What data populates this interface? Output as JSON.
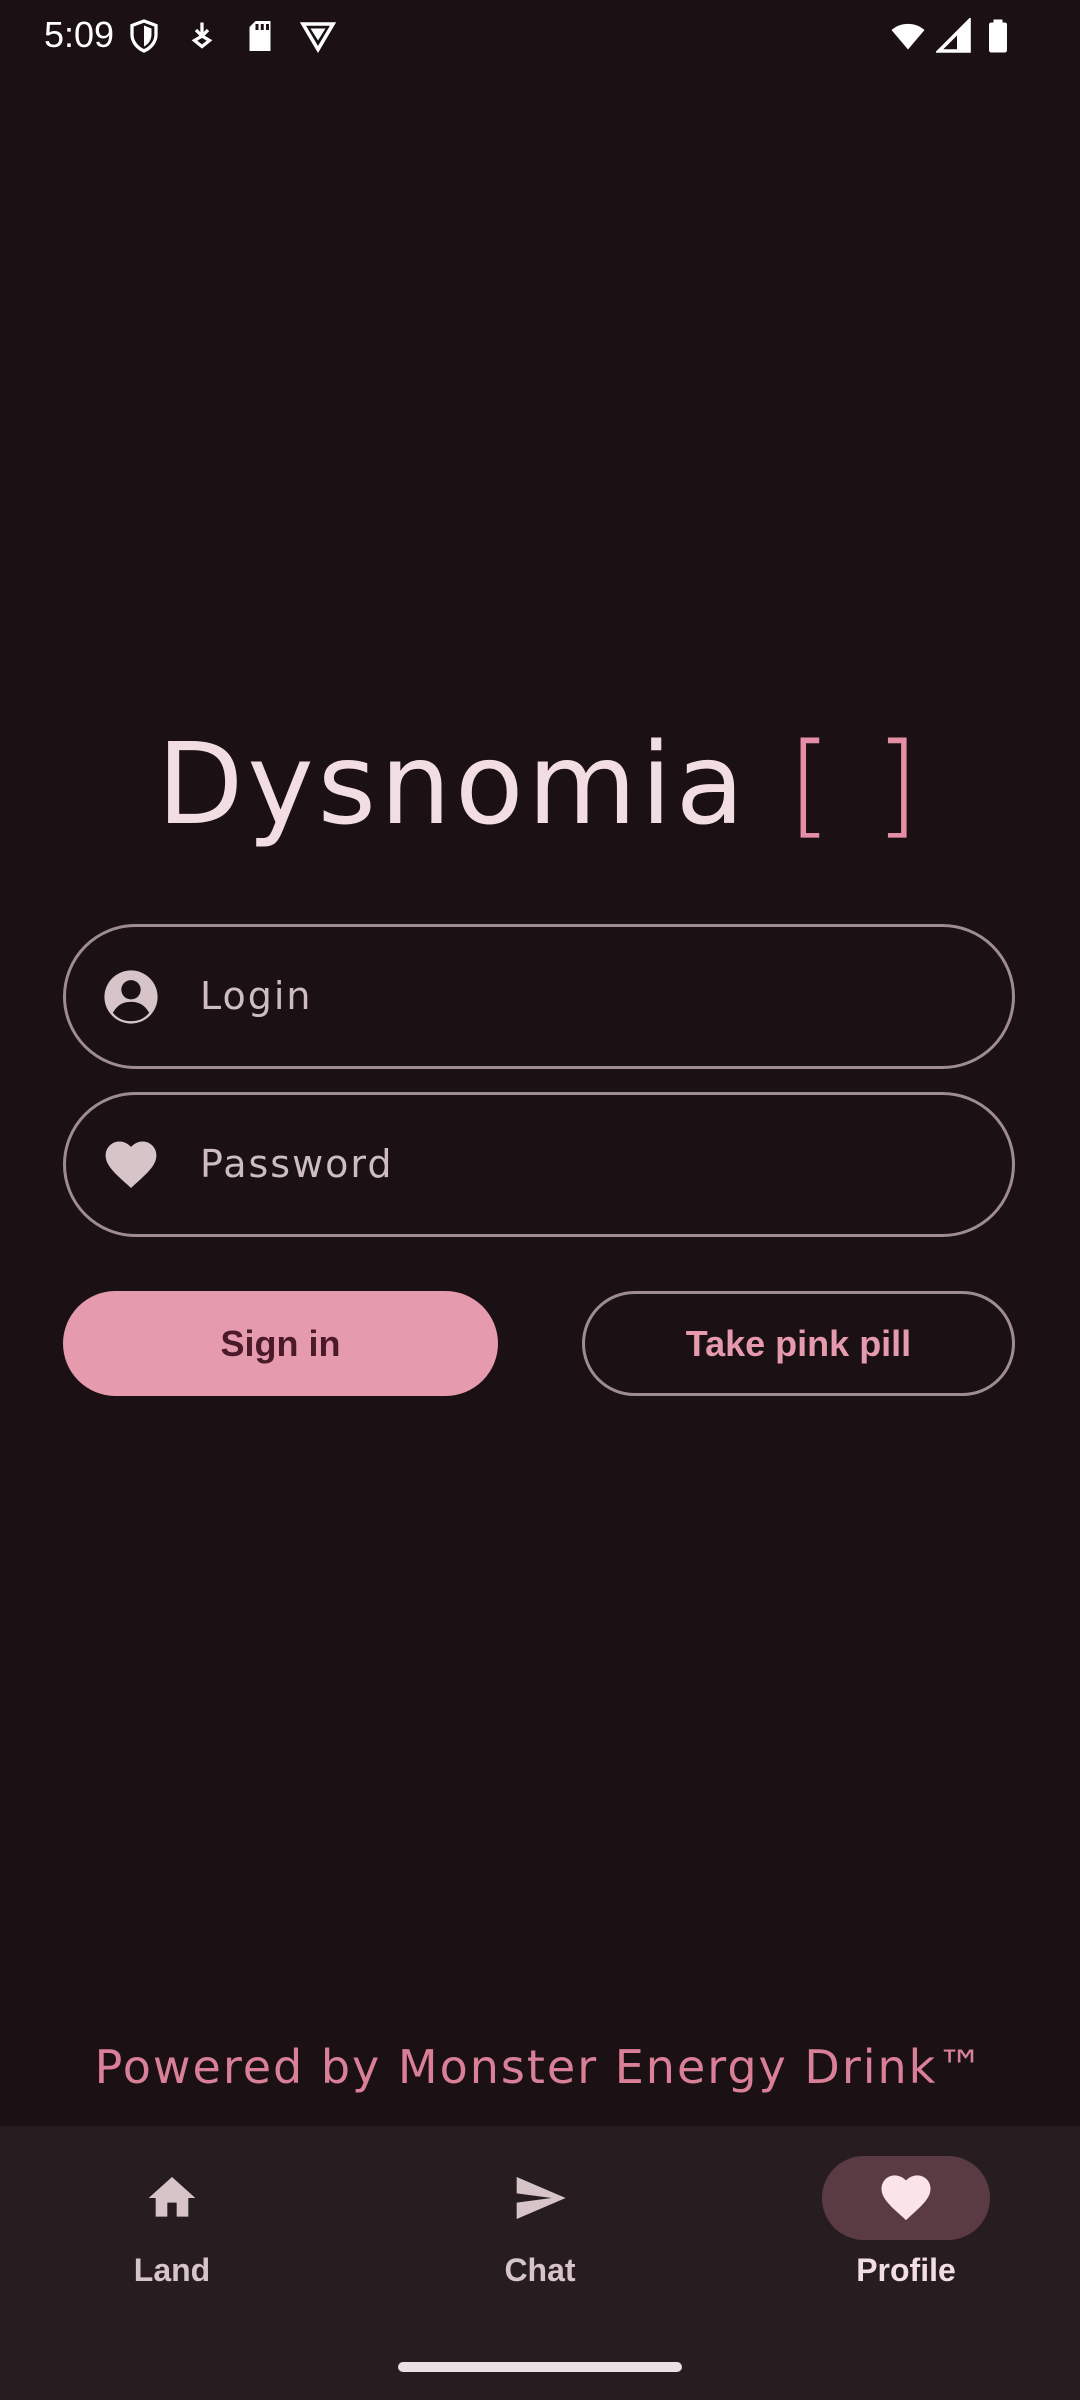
{
  "status_bar": {
    "time": "5:09",
    "left_icons": [
      "shield-icon",
      "download-icon",
      "sd-card-icon",
      "vpn-icon"
    ],
    "right_icons": [
      "wifi-icon",
      "signal-icon",
      "battery-icon"
    ]
  },
  "app": {
    "title": "Dysnomia",
    "title_brackets": "[ ]"
  },
  "form": {
    "login_placeholder": "Login",
    "password_placeholder": "Password",
    "signin_label": "Sign in",
    "pink_pill_label": "Take pink pill"
  },
  "footer": {
    "powered_by": "Powered by Monster Energy Drink™"
  },
  "nav": {
    "items": [
      {
        "label": "Land",
        "icon": "home-icon",
        "active": false
      },
      {
        "label": "Chat",
        "icon": "send-icon",
        "active": false
      },
      {
        "label": "Profile",
        "icon": "heart-icon",
        "active": true
      }
    ]
  },
  "colors": {
    "background": "#1b1115",
    "accent_pink": "#e59aad",
    "title_text": "#f2dde3",
    "nav_background": "#271d21",
    "nav_active_pill": "#5a3b43"
  }
}
